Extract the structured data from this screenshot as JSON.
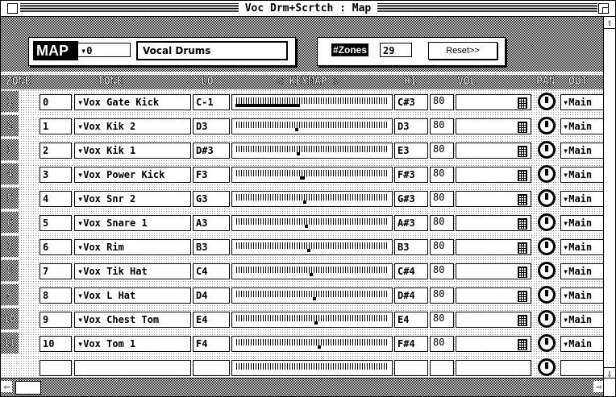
{
  "window": {
    "title": "Voc Drm+Scrtch : Map"
  },
  "map": {
    "label": "MAP",
    "number": "▾0",
    "name": "Vocal Drums"
  },
  "zones": {
    "label": "#Zones",
    "value": "29",
    "reset_label": "Reset>>"
  },
  "headers": {
    "zone": "ZONE",
    "tone": "TONE",
    "lo": "LO",
    "keymap": "< KEYMAP >",
    "hi": "HI",
    "vol": "VOL",
    "pan": "PAN",
    "out": "OUT"
  },
  "rows": [
    {
      "num": "1",
      "zone": "0",
      "tone": "▾Vox Gate Kick",
      "lo": "C-1",
      "hi": "C#3",
      "vol": "80",
      "out": "▾Main"
    },
    {
      "num": "2",
      "zone": "1",
      "tone": "▾Vox Kik 2",
      "lo": "D3",
      "hi": "D3",
      "vol": "80",
      "out": "▾Main"
    },
    {
      "num": "3",
      "zone": "2",
      "tone": "▾Vox Kik 1",
      "lo": "D#3",
      "hi": "E3",
      "vol": "80",
      "out": "▾Main"
    },
    {
      "num": "4",
      "zone": "3",
      "tone": "▾Vox Power Kick",
      "lo": "F3",
      "hi": "F#3",
      "vol": "80",
      "out": "▾Main"
    },
    {
      "num": "5",
      "zone": "4",
      "tone": "▾Vox Snr 2",
      "lo": "G3",
      "hi": "G#3",
      "vol": "80",
      "out": "▾Main"
    },
    {
      "num": "6",
      "zone": "5",
      "tone": "▾Vox Snare 1",
      "lo": "A3",
      "hi": "A#3",
      "vol": "80",
      "out": "▾Main"
    },
    {
      "num": "7",
      "zone": "6",
      "tone": "▾Vox Rim",
      "lo": "B3",
      "hi": "B3",
      "vol": "80",
      "out": "▾Main"
    },
    {
      "num": "8",
      "zone": "7",
      "tone": "▾Vox Tik Hat",
      "lo": "C4",
      "hi": "C#4",
      "vol": "80",
      "out": "▾Main"
    },
    {
      "num": "9",
      "zone": "8",
      "tone": "▾Vox L Hat",
      "lo": "D4",
      "hi": "D#4",
      "vol": "80",
      "out": "▾Main"
    },
    {
      "num": "10",
      "zone": "9",
      "tone": "▾Vox Chest Tom",
      "lo": "E4",
      "hi": "E4",
      "vol": "80",
      "out": "▾Main"
    },
    {
      "num": "11",
      "zone": "10",
      "tone": "▾Vox Tom 1",
      "lo": "F4",
      "hi": "F#4",
      "vol": "80",
      "out": "▾Main"
    }
  ],
  "icons": {
    "scroll_up": "arrow-up-icon",
    "scroll_down": "arrow-down-icon",
    "scroll_left": "arrow-left-icon",
    "scroll_right": "arrow-right-icon",
    "pan_knob": "knob-icon"
  }
}
